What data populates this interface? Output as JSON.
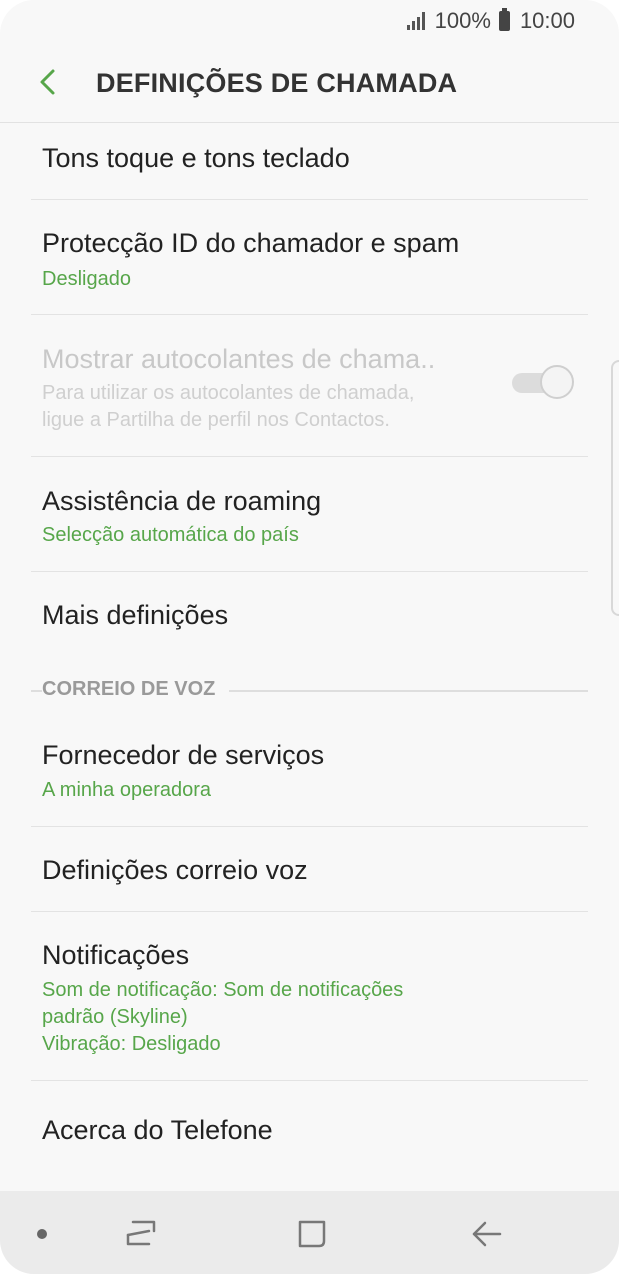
{
  "status_bar": {
    "battery_text": "100%",
    "time": "10:00",
    "icons": [
      "signal-icon",
      "battery-icon"
    ]
  },
  "header": {
    "title": "DEFINIÇÕES DE CHAMADA",
    "back_icon": "back-arrow-icon",
    "accent": "#57a64a"
  },
  "items": [
    {
      "title": "Tons toque e tons teclado"
    },
    {
      "title": "Protecção ID do chamador e spam",
      "subtitle": "Desligado"
    },
    {
      "title": "Mostrar autocolantes de chama..",
      "subtitle_line1": "Para utilizar os autocolantes de chamada,",
      "subtitle_line2": "ligue a Partilha de perfil nos Contactos.",
      "enabled": false,
      "toggle_on": false
    },
    {
      "title": "Assistência de roaming",
      "subtitle": "Selecção automática do país"
    },
    {
      "title": "Mais definições"
    }
  ],
  "voicemail_section": {
    "label": "CORREIO DE VOZ",
    "items": [
      {
        "title": "Fornecedor de serviços",
        "subtitle": "A minha operadora"
      },
      {
        "title": "Definições correio voz"
      },
      {
        "title": "Notificações",
        "subtitle_line1": "Som de notificação: Som de notificações",
        "subtitle_line2": "padrão (Skyline)",
        "subtitle_line3": "Vibração: Desligado"
      },
      {
        "title": "Acerca do Telefone"
      }
    ]
  },
  "nav_bar": {
    "icons": [
      "dot-icon",
      "recent-apps-icon",
      "home-icon",
      "back-icon"
    ]
  }
}
